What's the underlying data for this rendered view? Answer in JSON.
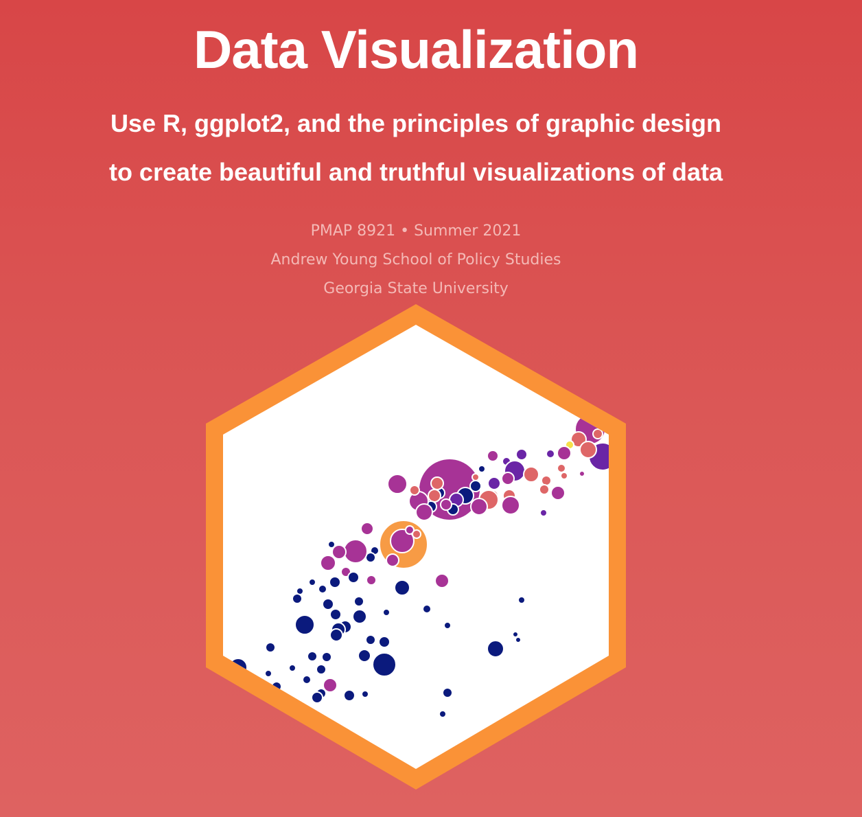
{
  "header": {
    "title": "Data Visualization",
    "subtitle_line1": "Use R, ggplot2, and the principles of graphic design",
    "subtitle_line2": "to create beautiful and truthful visualizations of data"
  },
  "course_info": {
    "course_term": "PMAP 8921 • Summer 2021",
    "school": "Andrew Young School of Policy Studies",
    "university": "Georgia State University"
  },
  "logo": {
    "icon": "gapminder-bubble-hex-icon",
    "border_color": "#fa9237",
    "fill_color": "#ffffff",
    "bubble_colors": {
      "navy": "#0b1a7d",
      "magenta": "#a73396",
      "purple": "#6a25a6",
      "pink": "#de6667",
      "orange": "#f79b45",
      "yellow": "#f6e049"
    }
  },
  "colors": {
    "background_top": "#d84647",
    "background_bottom": "#de6261",
    "title_text": "#ffffff",
    "meta_text": "#f4b9b6"
  }
}
